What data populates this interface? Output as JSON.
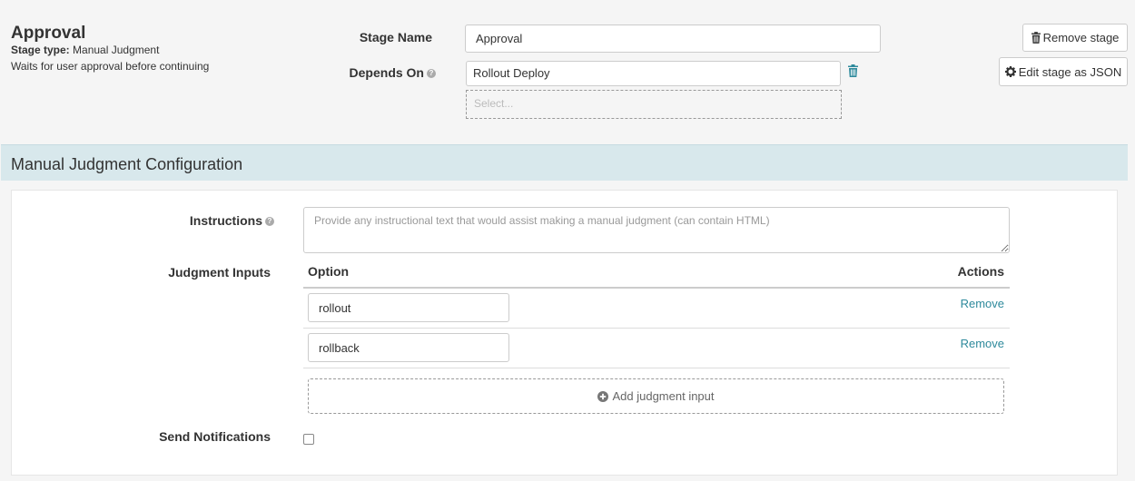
{
  "header": {
    "title": "Approval",
    "stage_type_label": "Stage type:",
    "stage_type_value": "Manual Judgment",
    "description": "Waits for user approval before continuing"
  },
  "form": {
    "stage_name_label": "Stage Name",
    "stage_name_value": "Approval",
    "depends_on_label": "Depends On",
    "depends_on_value": "Rollout Deploy",
    "depends_on_select_placeholder": "Select..."
  },
  "actions": {
    "remove_stage": "Remove stage",
    "edit_json": "Edit stage as JSON"
  },
  "section": {
    "title": "Manual Judgment Configuration"
  },
  "config": {
    "instructions_label": "Instructions",
    "instructions_placeholder": "Provide any instructional text that would assist making a manual judgment (can contain HTML)",
    "judgment_inputs_label": "Judgment Inputs",
    "option_header": "Option",
    "actions_header": "Actions",
    "options": [
      {
        "value": "rollout",
        "action": "Remove"
      },
      {
        "value": "rollback",
        "action": "Remove"
      }
    ],
    "add_input_label": "Add judgment input",
    "send_notifications_label": "Send Notifications",
    "send_notifications_checked": false
  },
  "colors": {
    "section_bg": "#d8e8ec",
    "link": "#2e8a9c",
    "trash_accent": "#2e8a9c"
  }
}
